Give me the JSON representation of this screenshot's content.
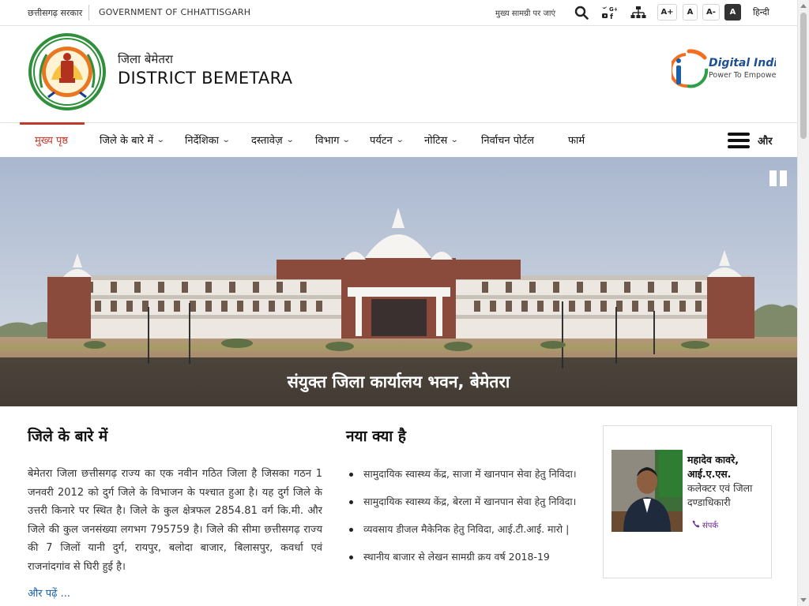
{
  "topbar": {
    "gov_hindi": "छत्तीसगढ़ सरकार",
    "gov_english": "GOVERNMENT OF CHHATTISGARH",
    "skip_link": "मुख्य सामग्री पर जाएं",
    "font_increase": "A+",
    "font_normal": "A",
    "font_decrease": "A-",
    "high_contrast": "A",
    "language": "हिन्दी",
    "icons": [
      "search-icon",
      "social-media-icon",
      "sitemap-icon"
    ]
  },
  "header": {
    "district_hindi": "जिला बेमेतरा",
    "district_english": "DISTRICT BEMETARA",
    "digital_india_title": "Digital India",
    "digital_india_tagline": "Power To Empower"
  },
  "nav": {
    "items": [
      {
        "label": "मुख्य पृष्ठ",
        "dropdown": false,
        "active": true
      },
      {
        "label": "जिले के बारे में",
        "dropdown": true
      },
      {
        "label": "निर्देशिका",
        "dropdown": true
      },
      {
        "label": "दस्तावेज़",
        "dropdown": true
      },
      {
        "label": "विभाग",
        "dropdown": true
      },
      {
        "label": "पर्यटन",
        "dropdown": true
      },
      {
        "label": "नोटिस",
        "dropdown": true
      },
      {
        "label": "निर्वाचन पोर्टल",
        "dropdown": false
      },
      {
        "label": "फार्म",
        "dropdown": false
      }
    ],
    "more_label": "और"
  },
  "hero": {
    "caption": "संयुक्त जिला कार्यालय भवन, बेमेतरा"
  },
  "about": {
    "title": "जिले के बारे में",
    "text": "बेमेतरा जिला छत्तीसगढ़ राज्य का एक नवीन गठित जिला है जिसका गठन 1 जनवरी 2012 को दुर्ग जिले के विभाजन के पश्चात हुआ है। यह दुर्ग जिले के उत्तरी किनारे पर स्थित है। जिले के कुल क्षेत्रफल 2854.81 वर्ग कि.मी. और जिले की कुल जनसंख्या लगभग 795759 है। जिले की सीमा छत्तीसगढ़ राज्य की 7 जिलों यानी दुर्ग, रायपुर, बलोदा बाजार, बिलासपुर, कवर्धा एवं राजनांदगांव से घिरी हुई है।",
    "read_more": "और पढ़ें ..."
  },
  "news": {
    "title": "नया क्या है",
    "items": [
      "सामुदायिक स्वास्थ्य केंद्र, साजा में खानपान सेवा हेतु निविदा।",
      "सामुदायिक स्वास्थ्य केंद्र, बेरला में खानपान सेवा हेतु निविदा।",
      "व्यवसाय डीजल मैकेनिक हेतु निविदा, आई.टी.आई. मारो |",
      "स्थानीय बाजार से लेखन सामग्री क्रय वर्ष 2018-19"
    ]
  },
  "collector": {
    "name": "महादेव कावरे, आई.ए.एस.",
    "role": "कलेक्टर एवं जिला दण्डाधिकारी",
    "contact": "संपर्क"
  },
  "colors": {
    "accent": "#c0392b",
    "link": "#1a5ea8",
    "contact": "#6a2c8e"
  }
}
